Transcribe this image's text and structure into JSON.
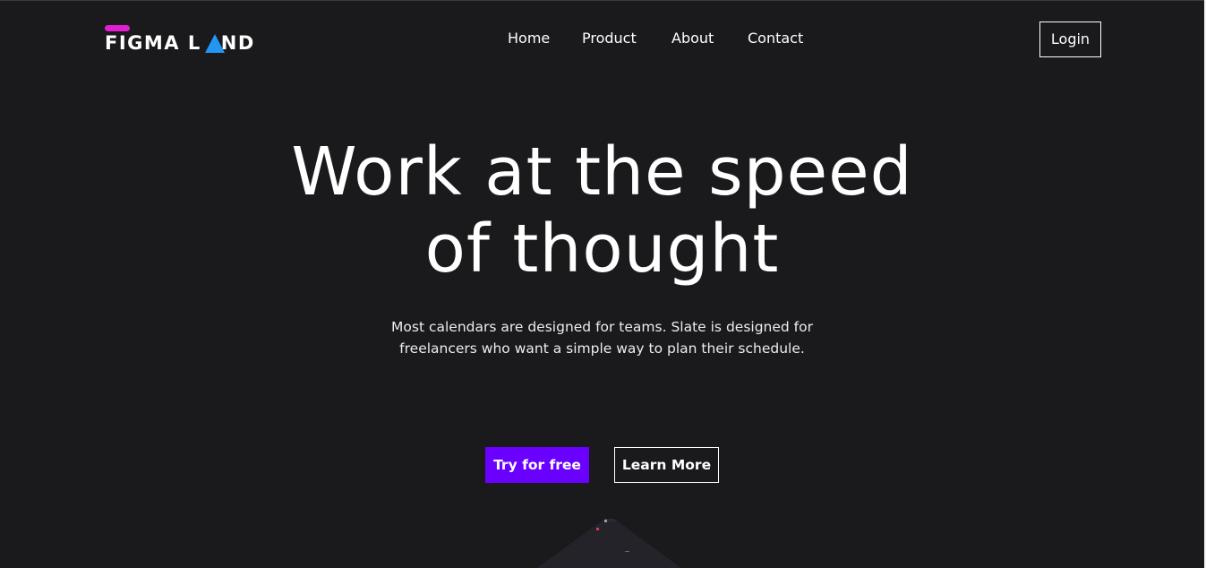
{
  "header": {
    "logo_text": "FIGMA LAND",
    "logo_pill_color": "#e11ed2",
    "logo_triangle_color": "#2196f3",
    "nav": {
      "home": "Home",
      "product": "Product",
      "about": "About",
      "contact": "Contact"
    },
    "login_label": "Login"
  },
  "hero": {
    "title_line1": "Work at the speed",
    "title_line2": "of thought",
    "subtitle_line1": "Most calendars are designed for teams. Slate is designed for",
    "subtitle_line2": "freelancers who want a simple way to plan their schedule.",
    "primary_cta": "Try for free",
    "secondary_cta": "Learn More"
  },
  "colors": {
    "background": "#1a191b",
    "accent": "#6a00ff",
    "text": "#ffffff"
  }
}
